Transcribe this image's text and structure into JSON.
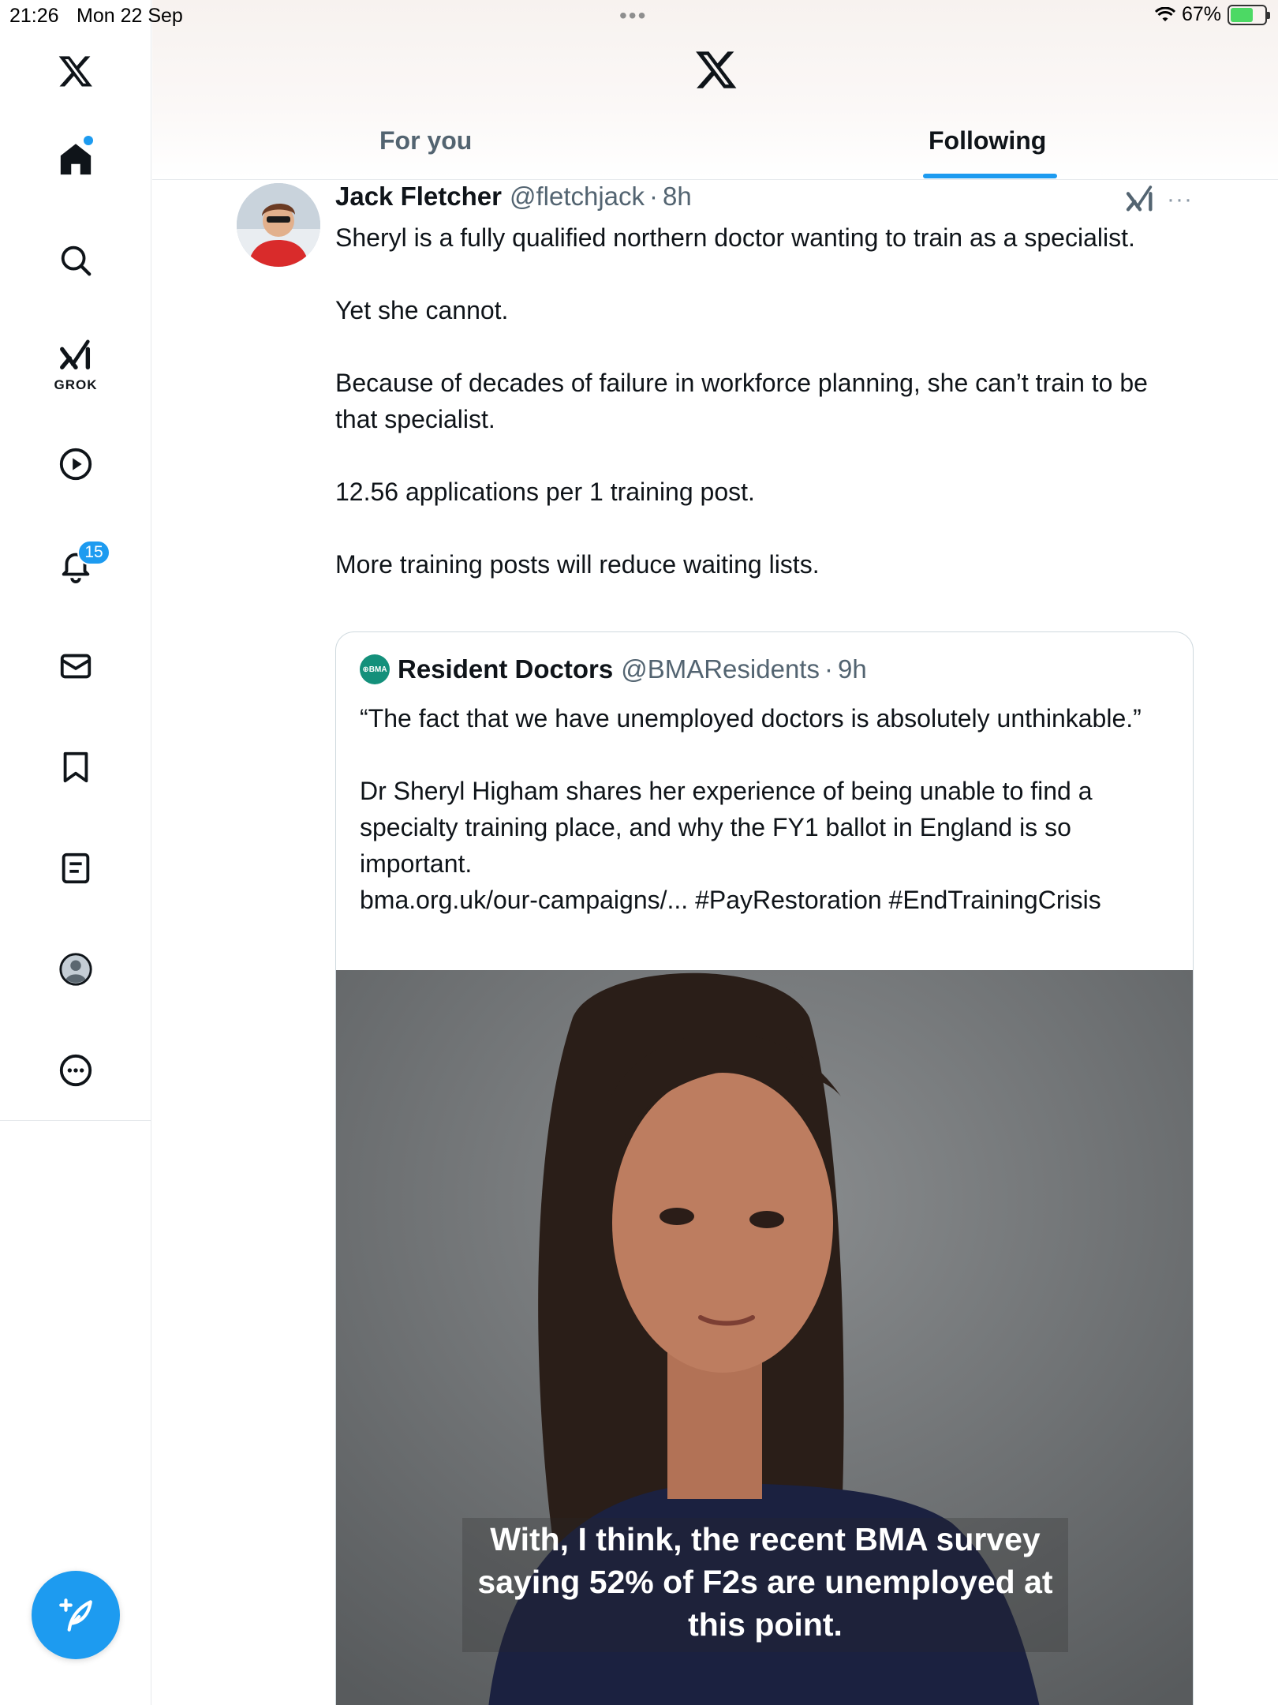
{
  "status_bar": {
    "time": "21:26",
    "date": "Mon 22 Sep",
    "battery": "67%",
    "battery_level": 0.67
  },
  "sidebar": {
    "items": [
      {
        "name": "home",
        "icon": "home-icon"
      },
      {
        "name": "explore",
        "icon": "search-icon"
      },
      {
        "name": "grok",
        "icon": "grok-icon",
        "label": "GROK"
      },
      {
        "name": "video",
        "icon": "play-icon"
      },
      {
        "name": "notifications",
        "icon": "bell-icon",
        "badge": "15"
      },
      {
        "name": "messages",
        "icon": "mail-icon"
      },
      {
        "name": "bookmarks",
        "icon": "bookmark-icon"
      },
      {
        "name": "lists",
        "icon": "list-icon"
      },
      {
        "name": "profile",
        "icon": "profile-icon"
      },
      {
        "name": "more",
        "icon": "more-circle-icon"
      }
    ],
    "compose_icon": "compose-icon"
  },
  "header": {
    "tabs": [
      {
        "label": "For you",
        "active": false
      },
      {
        "label": "Following",
        "active": true
      }
    ]
  },
  "tweet": {
    "author_name": "Jack Fletcher",
    "author_handle": "@fletchjack",
    "separator": "·",
    "time": "8h",
    "paragraphs": [
      "Sheryl is a fully qualified northern doctor wanting to train as a specialist.",
      "Yet she cannot.",
      "Because of decades of failure in workforce planning, she can’t train to be that specialist.",
      "12.56 applications per 1 training post.",
      "More training posts will reduce waiting lists."
    ],
    "more": "···"
  },
  "quote": {
    "logo_text": "⊕BMA",
    "author_name": "Resident Doctors",
    "author_handle": "@BMAResidents",
    "separator": "·",
    "time": "9h",
    "line1": "“The fact that we have unemployed doctors is absolutely unthinkable.”",
    "line2": "Dr Sheryl Higham shares her experience of being unable to find a specialty training place, and why the FY1 ballot in England is so important.",
    "line3": "bma.org.uk/our-campaigns/... #PayRestoration #EndTrainingCrisis",
    "caption": "With, I think, the recent BMA survey saying 52% of F2s are unemployed at this point."
  },
  "colors": {
    "accent": "#1d9bf0",
    "text": "#0f1419",
    "secondary": "#536471",
    "border": "#cfd9de"
  }
}
